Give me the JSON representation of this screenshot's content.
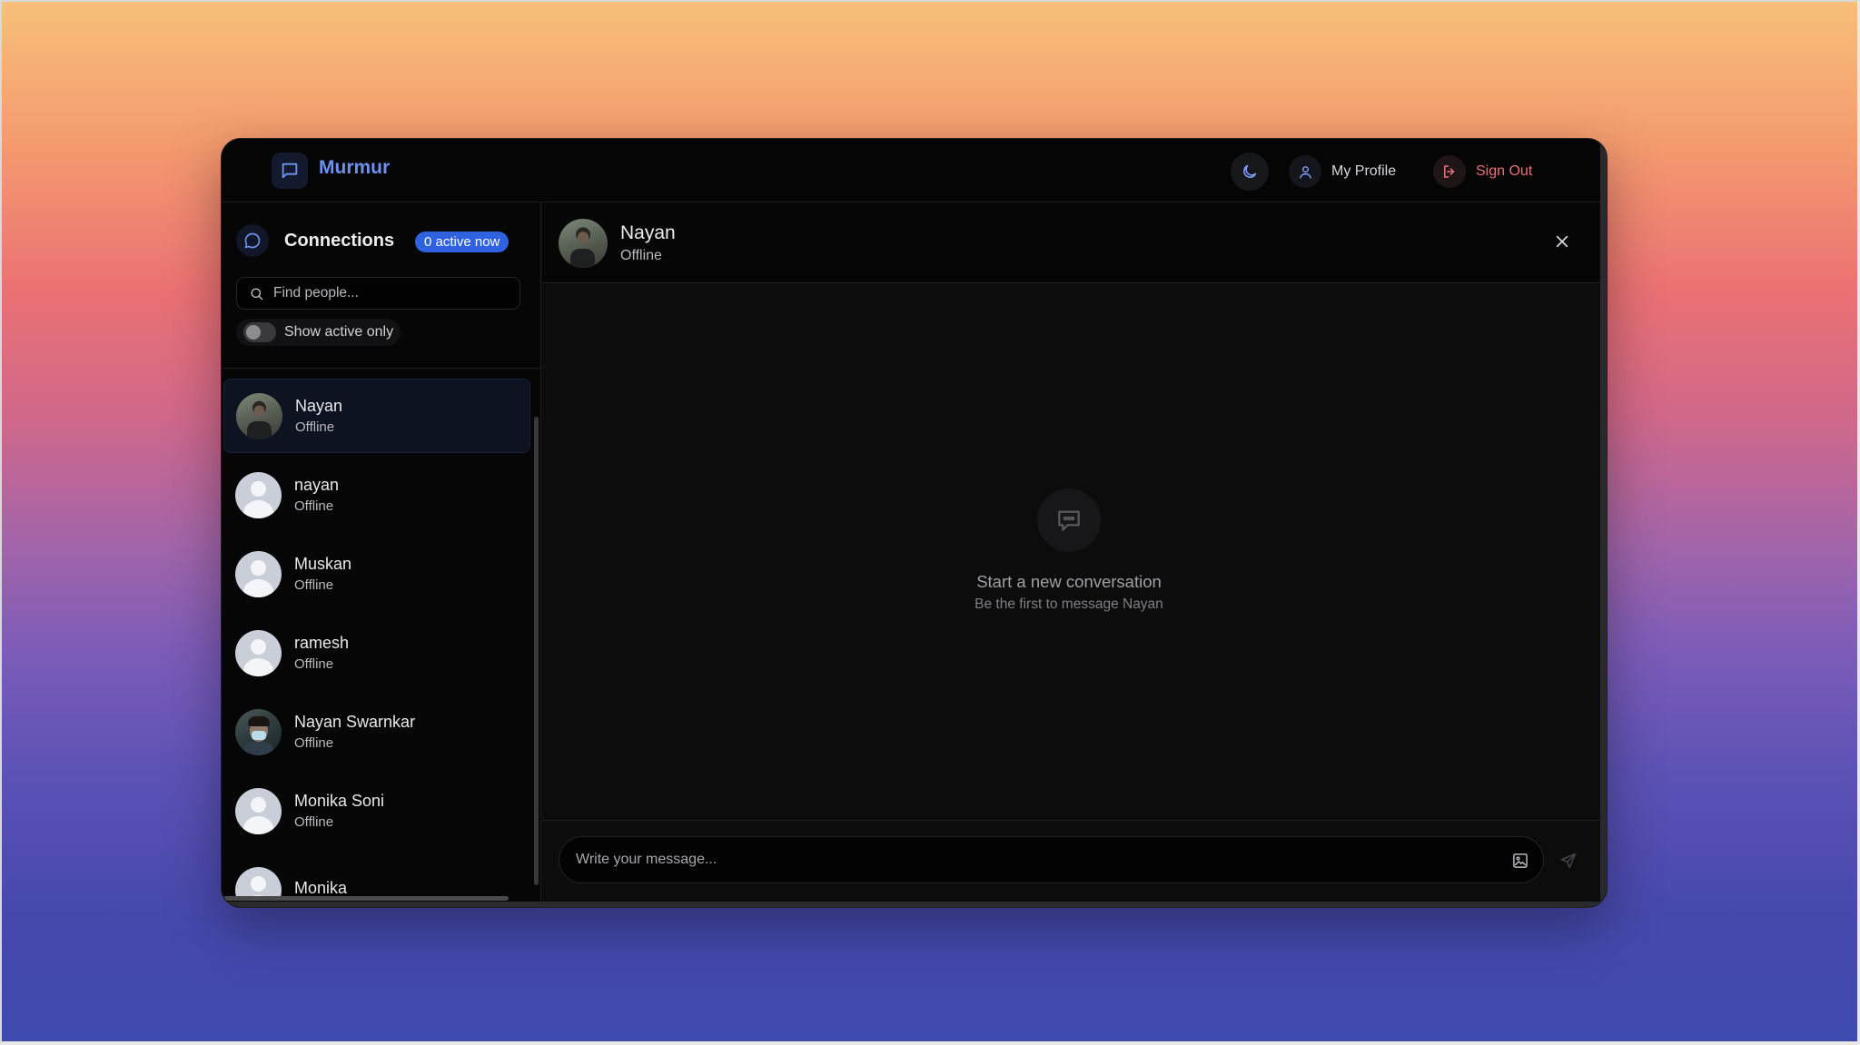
{
  "app": {
    "name": "Murmur",
    "accent_color": "#6d92f0",
    "logo_icon": "chat-bubble-icon"
  },
  "header": {
    "theme_toggle_icon": "moon-icon",
    "profile_label": "My Profile",
    "profile_icon": "user-icon",
    "signout_label": "Sign Out",
    "signout_icon": "logout-icon",
    "signout_color": "#ee6f7a"
  },
  "sidebar": {
    "title": "Connections",
    "title_icon": "chat-circle-icon",
    "active_badge": "0 active now",
    "badge_color": "#2e62e0",
    "search": {
      "placeholder": "Find people...",
      "value": ""
    },
    "filter": {
      "label": "Show active only",
      "checked": false
    },
    "contacts": [
      {
        "name": "Nayan",
        "status": "Offline",
        "avatar": "photo",
        "selected": true
      },
      {
        "name": "nayan",
        "status": "Offline",
        "avatar": "default",
        "selected": false
      },
      {
        "name": "Muskan",
        "status": "Offline",
        "avatar": "default",
        "selected": false
      },
      {
        "name": "ramesh",
        "status": "Offline",
        "avatar": "default",
        "selected": false
      },
      {
        "name": "Nayan Swarnkar",
        "status": "Offline",
        "avatar": "photo",
        "selected": false
      },
      {
        "name": "Monika Soni",
        "status": "Offline",
        "avatar": "default",
        "selected": false
      },
      {
        "name": "Monika",
        "status": "",
        "avatar": "default",
        "selected": false
      }
    ]
  },
  "chat": {
    "name": "Nayan",
    "status": "Offline",
    "close_icon": "close-icon",
    "empty_state": {
      "icon": "message-dots-icon",
      "title": "Start a new conversation",
      "subtitle": "Be the first to message Nayan"
    },
    "composer": {
      "placeholder": "Write your message...",
      "value": "",
      "image_icon": "image-icon",
      "send_icon": "send-icon"
    }
  }
}
